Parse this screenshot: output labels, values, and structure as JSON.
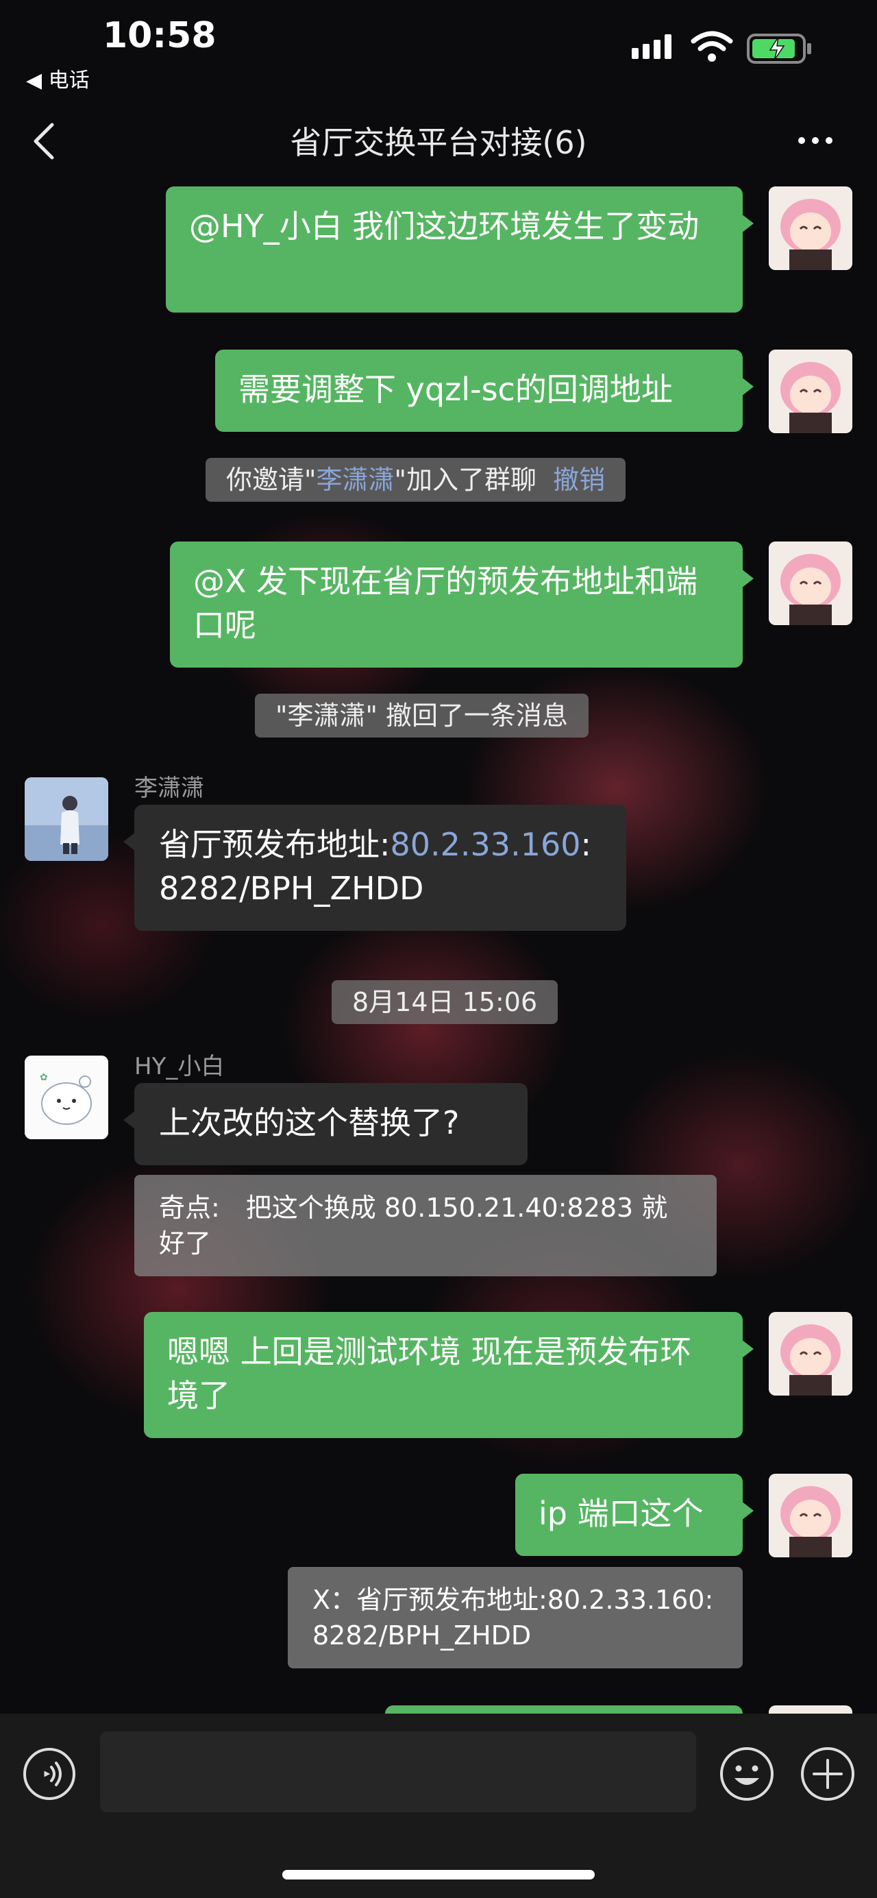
{
  "status_bar": {
    "time": "10:58",
    "back_app": "◀ 电话"
  },
  "header": {
    "title": "省厅交换平台对接(6)"
  },
  "messages": {
    "m1": "@HY_小白 我们这边环境发生了变动",
    "m2": "需要调整下 yqzl-sc的回调地址",
    "sys1": {
      "prefix": "你邀请\"",
      "name": "李潇潇",
      "suffix": "\"加入了群聊",
      "action": "撤销"
    },
    "m3": "@X 发下现在省厅的预发布地址和端口呢",
    "sys2": "\"李潇潇\" 撤回了一条消息",
    "m4": {
      "sender": "李潇潇",
      "prefix": "省厅预发布地址:",
      "link": "80.2.33.160",
      "suffix": ":8282/BPH_ZHDD"
    },
    "timestamp": "8月14日 15:06",
    "m5": {
      "sender": "HY_小白",
      "text": "上次改的这个替换了?",
      "quote": "奇点:　把这个换成 80.150.21.40:8283 就好了"
    },
    "m6": "嗯嗯 上回是测试环境 现在是预发布环境了",
    "m7": {
      "text": "ip 端口这个",
      "quote": "X：省厅预发布地址:80.2.33.160:8282/BPH_ZHDD"
    }
  },
  "colors": {
    "bubble_green": "#56b562",
    "bubble_dark": "#2c2c2c",
    "link": "#8aa6d8"
  },
  "icons": [
    "back-icon",
    "more-icon",
    "voice-icon",
    "emoji-icon",
    "plus-icon",
    "wifi-icon",
    "battery-icon",
    "signal-icon"
  ]
}
